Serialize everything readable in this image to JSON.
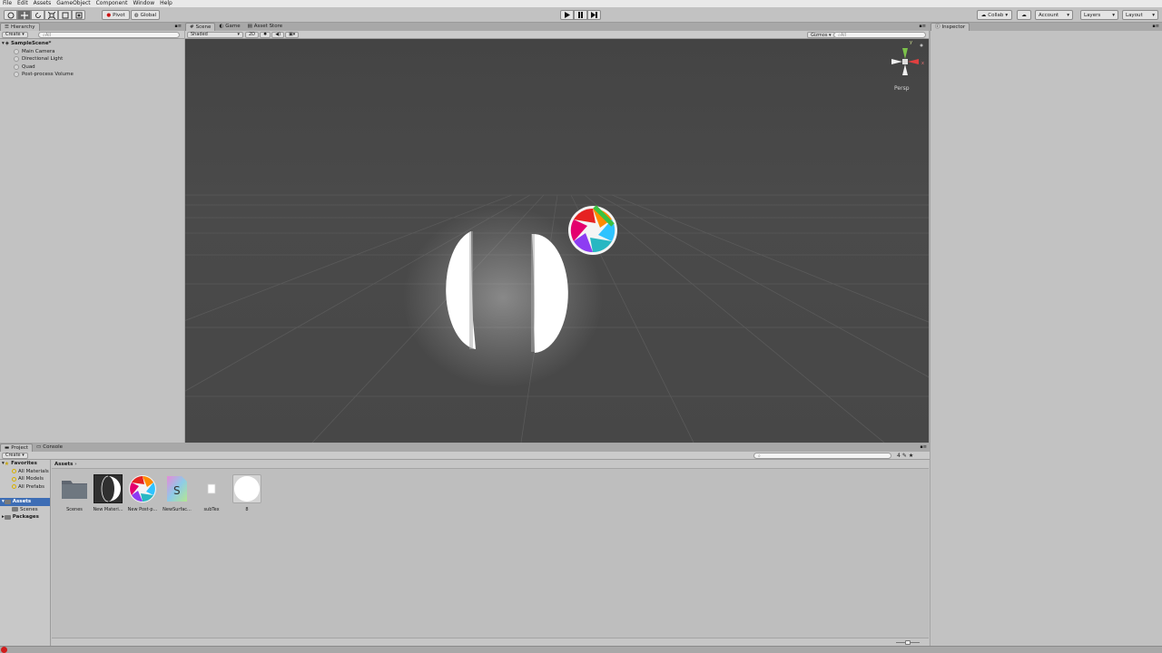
{
  "menu": [
    "File",
    "Edit",
    "Assets",
    "GameObject",
    "Component",
    "Window",
    "Help"
  ],
  "toolbar": {
    "pivot": "Pivot",
    "global": "Global",
    "collab": "Collab",
    "account": "Account",
    "layers": "Layers",
    "layout": "Layout",
    "tools": [
      "hand-tool-icon",
      "move-tool-icon",
      "rotate-tool-icon",
      "scale-tool-icon",
      "rect-tool-icon",
      "transform-tool-icon"
    ]
  },
  "hierarchy": {
    "tab": "Hierarchy",
    "create": "Create",
    "search_placeholder": "All",
    "scene": "SampleScene*",
    "items": [
      "Main Camera",
      "Directional Light",
      "Quad",
      "Post-process Volume"
    ]
  },
  "scene": {
    "tabs": [
      "Scene",
      "Game",
      "Asset Store"
    ],
    "shading": "Shaded",
    "mode_2d": "2D",
    "gizmos": "Gizmos",
    "search_placeholder": "All",
    "persp": "Persp",
    "gizmo_axes": {
      "y": "y",
      "x": "x"
    }
  },
  "inspector": {
    "tab": "Inspector"
  },
  "project": {
    "tabs": [
      "Project",
      "Console"
    ],
    "create": "Create",
    "favorites_label": "Favorites",
    "favorites": [
      "All Materials",
      "All Models",
      "All Prefabs"
    ],
    "assets_root": "Assets",
    "assets_children": [
      "Scenes"
    ],
    "packages": "Packages",
    "breadcrumb": "Assets",
    "badge_count": "4",
    "assets": [
      {
        "name": "Scenes",
        "kind": "folder"
      },
      {
        "name": "New Materi...",
        "kind": "material"
      },
      {
        "name": "New Post-p...",
        "kind": "postprocess"
      },
      {
        "name": "NewSurfac...",
        "kind": "shader"
      },
      {
        "name": "subTex",
        "kind": "texture"
      },
      {
        "name": "8",
        "kind": "sprite"
      }
    ]
  },
  "colors": {
    "accent": "#3d6db5",
    "scene_bg": "#474747",
    "panel_bg": "#c2c2c2",
    "error": "#d01c1c"
  }
}
